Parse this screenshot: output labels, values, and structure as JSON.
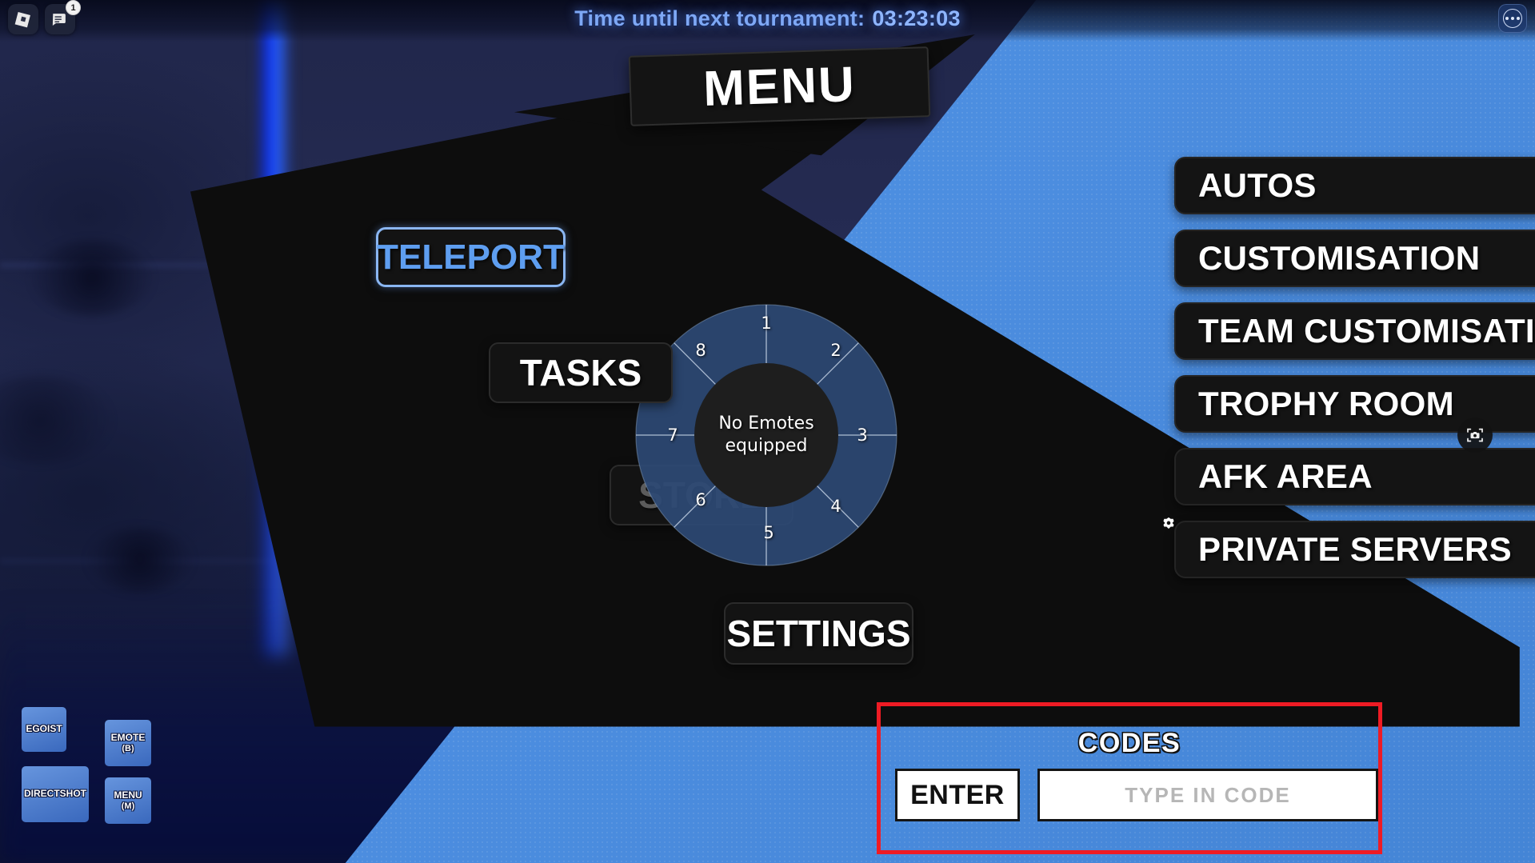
{
  "topbar": {
    "roblox_logo_icon": "roblox-logo-icon",
    "chat_icon": "chat-icon",
    "chat_badge": "1",
    "more_icon": "more-options-icon",
    "timer_label": "Time until next tournament:",
    "timer_value": "03:23:03"
  },
  "menu": {
    "title": "MENU"
  },
  "left_buttons": [
    {
      "id": "teleport",
      "label": "TELEPORT",
      "state": "highlighted"
    },
    {
      "id": "tasks",
      "label": "TASKS",
      "state": "normal"
    },
    {
      "id": "store",
      "label": "STORE",
      "state": "dimmed"
    },
    {
      "id": "settings",
      "label": "SETTINGS",
      "state": "normal"
    }
  ],
  "right_buttons": [
    {
      "id": "autos",
      "label": "AUTOS",
      "icon": ""
    },
    {
      "id": "customisation",
      "label": "CUSTOMISATION",
      "icon": ""
    },
    {
      "id": "team-customisation",
      "label": "TEAM CUSTOMISATION",
      "icon": ""
    },
    {
      "id": "trophy-room",
      "label": "TROPHY ROOM",
      "icon": ""
    },
    {
      "id": "afk-area",
      "label": "AFK AREA",
      "icon": ""
    },
    {
      "id": "private-servers",
      "label": "PRIVATE SERVERS",
      "icon": "gear-badge-icon"
    }
  ],
  "camera_overlay": {
    "icon": "screenshot-camera-icon"
  },
  "emote_wheel": {
    "center_text_line1": "No Emotes",
    "center_text_line2": "equipped",
    "slots": [
      "1",
      "2",
      "3",
      "4",
      "5",
      "6",
      "7",
      "8"
    ]
  },
  "codes": {
    "title": "CODES",
    "enter_label": "ENTER",
    "input_value": "",
    "input_placeholder": "TYPE IN CODE",
    "highlight_color": "#ee1b24"
  },
  "action_buttons": [
    {
      "id": "egoist",
      "label": "EGOIST",
      "key": ""
    },
    {
      "id": "directshot",
      "label": "DIRECTSHOT",
      "key": ""
    },
    {
      "id": "emote",
      "label": "EMOTE",
      "key": "(B)"
    },
    {
      "id": "menu",
      "label": "MENU",
      "key": "(M)"
    }
  ],
  "colors": {
    "accent_blue": "#4a90e8",
    "panel_black": "#141414",
    "highlight_red": "#ee1b24",
    "teleport_blue": "#5e9ef0"
  }
}
